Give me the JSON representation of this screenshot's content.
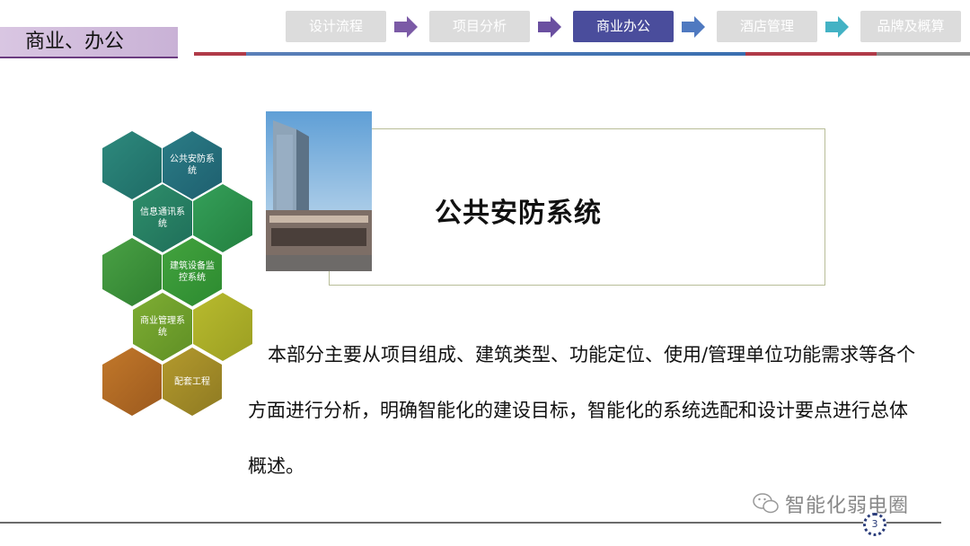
{
  "section": {
    "label": "商业、办公"
  },
  "nav": {
    "tabs": [
      {
        "label": "设计流程"
      },
      {
        "label": "项目分析"
      },
      {
        "label": "商业办公",
        "active": true
      },
      {
        "label": "酒店管理"
      },
      {
        "label": "品牌及概算"
      }
    ]
  },
  "hexagons": [
    {
      "label": ""
    },
    {
      "label": "公共安防系统"
    },
    {
      "label": "信息通讯系统"
    },
    {
      "label": ""
    },
    {
      "label": ""
    },
    {
      "label": "建筑设备监控系统"
    },
    {
      "label": "商业管理系统"
    },
    {
      "label": ""
    },
    {
      "label": ""
    },
    {
      "label": "配套工程"
    }
  ],
  "main": {
    "title": "公共安防系统",
    "body_line1": "本部分主要从项目组成、建筑类型、功能定位、使用/管理单位功能需求等各个",
    "body_line2": "方面进行分析，明确智能化的建设目标，智能化的系统选配和设计要点进行总体",
    "body_line3": "概述。"
  },
  "footer": {
    "watermark": "智能化弱电圈",
    "page_number": "3"
  },
  "colors": {
    "accent_purple": "#4a4d9c",
    "section_bg": "#d9c6e2",
    "arrow_purple": "#7b5aa6",
    "arrow_blue": "#4f79c0",
    "arrow_teal": "#43b2c4"
  }
}
